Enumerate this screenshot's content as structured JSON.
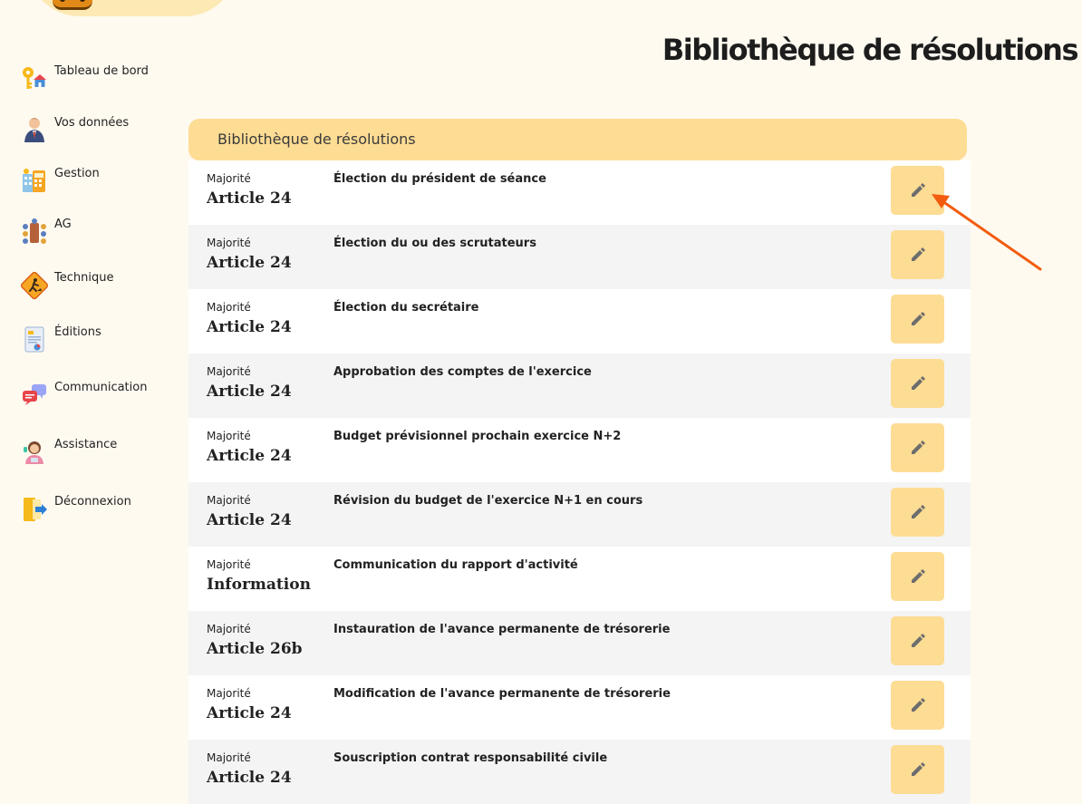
{
  "page": {
    "title": "Bibliothèque de résolutions"
  },
  "sidebar": {
    "items": [
      {
        "label": "Tableau de bord",
        "icon": "key-house-icon"
      },
      {
        "label": "Vos données",
        "icon": "user-icon"
      },
      {
        "label": "Gestion",
        "icon": "building-calculator-icon"
      },
      {
        "label": "AG",
        "icon": "meeting-icon"
      },
      {
        "label": "Technique",
        "icon": "worker-sign-icon"
      },
      {
        "label": "Éditions",
        "icon": "report-icon"
      },
      {
        "label": "Communication",
        "icon": "chat-bubbles-icon"
      },
      {
        "label": "Assistance",
        "icon": "support-agent-icon"
      },
      {
        "label": "Déconnexion",
        "icon": "logout-door-icon"
      }
    ]
  },
  "panel": {
    "header": "Bibliothèque de résolutions",
    "majority_label": "Majorité",
    "rows": [
      {
        "majority": "Article 24",
        "title": "Élection du président de séance"
      },
      {
        "majority": "Article 24",
        "title": "Élection du ou des scrutateurs"
      },
      {
        "majority": "Article 24",
        "title": "Élection du secrétaire"
      },
      {
        "majority": "Article 24",
        "title": "Approbation des comptes de l'exercice"
      },
      {
        "majority": "Article 24",
        "title": "Budget prévisionnel prochain exercice N+2"
      },
      {
        "majority": "Article 24",
        "title": "Révision du budget de l'exercice N+1 en cours"
      },
      {
        "majority": "Information",
        "title": "Communication du rapport d'activité"
      },
      {
        "majority": "Article 26b",
        "title": "Instauration de l'avance permanente de trésorerie"
      },
      {
        "majority": "Article 24",
        "title": "Modification de l'avance permanente de trésorerie"
      },
      {
        "majority": "Article 24",
        "title": "Souscription contrat responsabilité civile"
      }
    ]
  },
  "colors": {
    "background": "#fffaf0",
    "accent": "#fddc94",
    "annotation_arrow": "#f25c0f"
  }
}
